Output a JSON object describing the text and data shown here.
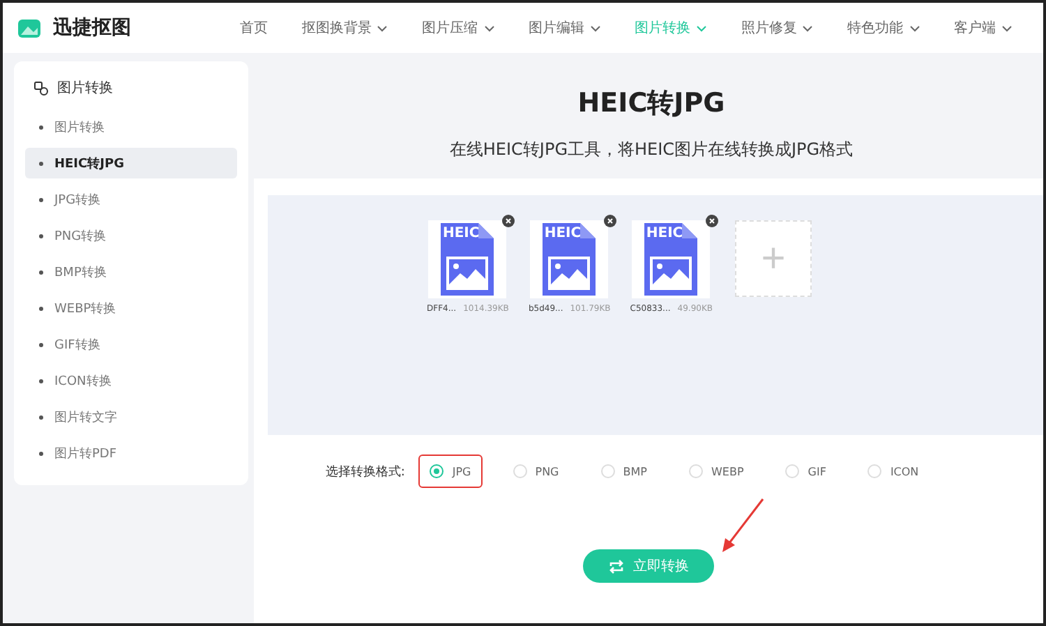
{
  "header": {
    "logo": "迅捷抠图",
    "nav": [
      {
        "label": "首页",
        "selected": false,
        "dropdown": false
      },
      {
        "label": "抠图换背景",
        "selected": false,
        "dropdown": true
      },
      {
        "label": "图片压缩",
        "selected": false,
        "dropdown": true
      },
      {
        "label": "图片编辑",
        "selected": false,
        "dropdown": true
      },
      {
        "label": "图片转换",
        "selected": true,
        "dropdown": true
      },
      {
        "label": "照片修复",
        "selected": false,
        "dropdown": true
      },
      {
        "label": "特色功能",
        "selected": false,
        "dropdown": true
      },
      {
        "label": "客户端",
        "selected": false,
        "dropdown": true
      }
    ]
  },
  "sidebar": {
    "title": "图片转换",
    "items": [
      {
        "label": "图片转换",
        "selected": false
      },
      {
        "label": "HEIC转JPG",
        "selected": true
      },
      {
        "label": "JPG转换",
        "selected": false
      },
      {
        "label": "PNG转换",
        "selected": false
      },
      {
        "label": "BMP转换",
        "selected": false
      },
      {
        "label": "WEBP转换",
        "selected": false
      },
      {
        "label": "GIF转换",
        "selected": false
      },
      {
        "label": "ICON转换",
        "selected": false
      },
      {
        "label": "图片转文字",
        "selected": false
      },
      {
        "label": "图片转PDF",
        "selected": false
      }
    ]
  },
  "main": {
    "title": "HEIC转JPG",
    "subtitle": "在线HEIC转JPG工具，将HEIC图片在线转换成JPG格式",
    "files": [
      {
        "badge": "HEIC",
        "name": "DFF4...",
        "size": "1014.39KB"
      },
      {
        "badge": "HEIC",
        "name": "b5d49...",
        "size": "101.79KB"
      },
      {
        "badge": "HEIC",
        "name": "C50833...",
        "size": "49.90KB"
      }
    ],
    "add_tile": "+",
    "format_label": "选择转换格式:",
    "formats": [
      {
        "label": "JPG",
        "selected": true
      },
      {
        "label": "PNG",
        "selected": false
      },
      {
        "label": "BMP",
        "selected": false
      },
      {
        "label": "WEBP",
        "selected": false
      },
      {
        "label": "GIF",
        "selected": false
      },
      {
        "label": "ICON",
        "selected": false
      }
    ],
    "convert_button": "立即转换"
  }
}
